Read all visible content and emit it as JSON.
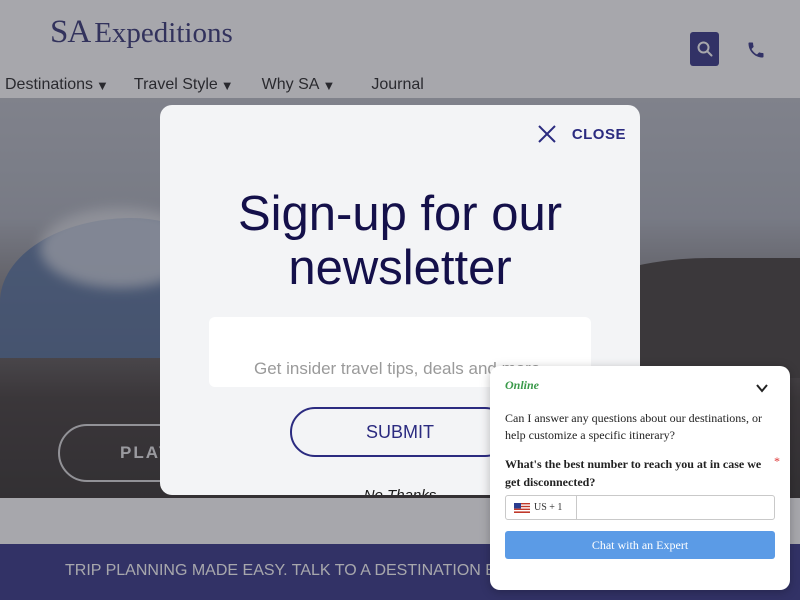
{
  "header": {
    "logo_sa": "SA",
    "logo_text": "Expeditions",
    "nav": [
      {
        "label": "Destinations",
        "caret": "▼"
      },
      {
        "label": "Travel Style",
        "caret": "▼"
      },
      {
        "label": "Why SA",
        "caret": "▼"
      },
      {
        "label": "Journal",
        "caret": ""
      }
    ]
  },
  "hero": {
    "play_label": "PLAY"
  },
  "banner": {
    "text": "TRIP PLANNING MADE EASY. TALK TO A DESTINATION EXP"
  },
  "modal": {
    "close_label": "CLOSE",
    "title_line1": "Sign-up for our",
    "title_line2": "newsletter",
    "email_placeholder": "Get insider travel tips, deals and more",
    "submit_label": "SUBMIT",
    "no_thanks_label": "No Thanks"
  },
  "chat": {
    "status": "Online",
    "intro": "Can I answer any questions about our destinations, or help customize a specific itinerary?",
    "question": "What's the best number to reach you at in case we get disconnected?",
    "required_mark": "*",
    "country_code": "US + 1",
    "button_label": "Chat with an Expert"
  },
  "colors": {
    "brand": "#2b2b80",
    "title": "#14104a",
    "chat_button": "#5b9be6",
    "online": "#3a9a4a"
  },
  "icons": [
    "search-icon",
    "phone-icon",
    "close-icon",
    "chevron-down-icon",
    "us-flag-icon"
  ]
}
